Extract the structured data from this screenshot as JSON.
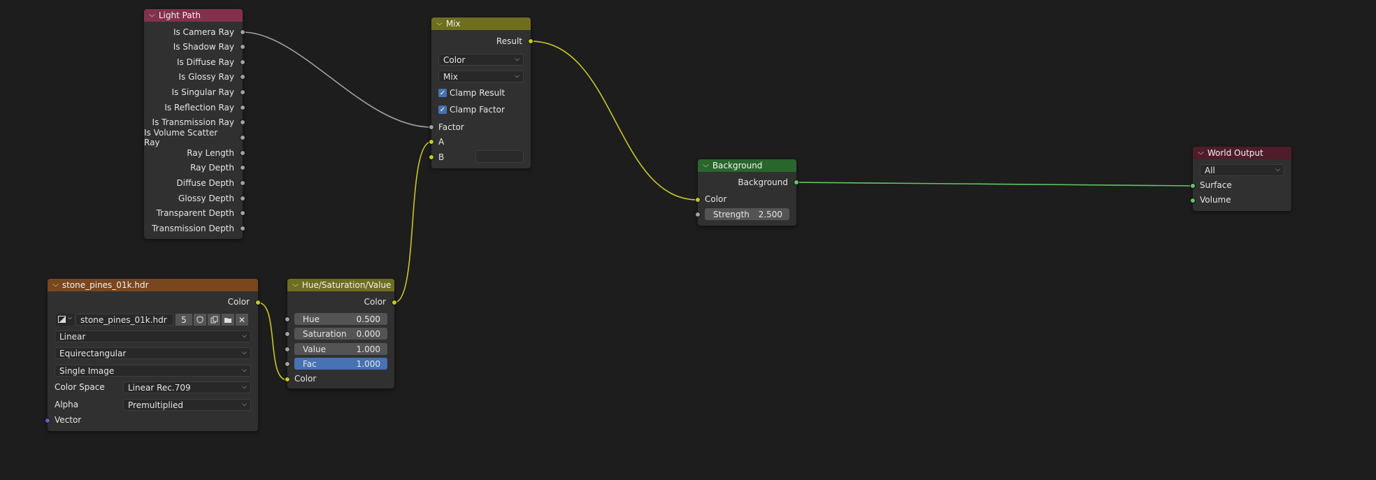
{
  "colors": {
    "background": "#1d1d1d",
    "node_body": "#303030",
    "header_input": "#83314a",
    "header_converter": "#6e6e1f",
    "header_texture": "#79461d",
    "header_shader": "#28662c",
    "header_output": "#4f1c2a",
    "socket_grey": "#a1a1a1",
    "socket_yellow": "#c7c729",
    "socket_green": "#63c763",
    "socket_purple": "#6363c7",
    "accent_blue": "#4772b3"
  },
  "light_path": {
    "title": "Light Path",
    "outputs": [
      "Is Camera Ray",
      "Is Shadow Ray",
      "Is Diffuse Ray",
      "Is Glossy Ray",
      "Is Singular Ray",
      "Is Reflection Ray",
      "Is Transmission Ray",
      "Is Volume Scatter Ray",
      "Ray Length",
      "Ray Depth",
      "Diffuse Depth",
      "Glossy Depth",
      "Transparent Depth",
      "Transmission Depth"
    ]
  },
  "mix": {
    "title": "Mix",
    "output": "Result",
    "data_type": "Color",
    "blend_type": "Mix",
    "clamp_result": "Clamp Result",
    "clamp_factor": "Clamp Factor",
    "input_factor": "Factor",
    "input_a": "A",
    "input_b": "B"
  },
  "background": {
    "title": "Background",
    "output": "Background",
    "input_color": "Color",
    "strength_label": "Strength",
    "strength_value": "2.500"
  },
  "world_output": {
    "title": "World Output",
    "target": "All",
    "input_surface": "Surface",
    "input_volume": "Volume"
  },
  "image_texture": {
    "title": "stone_pines_01k.hdr",
    "output": "Color",
    "image_name": "stone_pines_01k.hdr",
    "users": "5",
    "interpolation": "Linear",
    "projection": "Equirectangular",
    "source": "Single Image",
    "color_space_label": "Color Space",
    "color_space_value": "Linear Rec.709",
    "alpha_label": "Alpha",
    "alpha_value": "Premultiplied",
    "input_vector": "Vector"
  },
  "hsv": {
    "title": "Hue/Saturation/Value",
    "output": "Color",
    "hue_label": "Hue",
    "hue_value": "0.500",
    "saturation_label": "Saturation",
    "saturation_value": "0.000",
    "value_label": "Value",
    "value_value": "1.000",
    "fac_label": "Fac",
    "fac_value": "1.000",
    "input_color": "Color"
  }
}
